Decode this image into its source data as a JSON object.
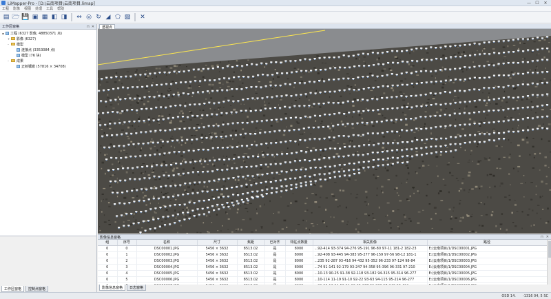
{
  "window": {
    "title": "LiMapper-Pro - [D:\\云南项目\\云南项目.limap]",
    "controls": [
      "—",
      "☐",
      "✕"
    ]
  },
  "menu": [
    "工程",
    "影像",
    "视图",
    "处理",
    "工具",
    "帮助"
  ],
  "toolbar": {
    "icons": [
      "new-file-icon",
      "open-folder-icon",
      "save-icon",
      "image-icon",
      "image-add-icon",
      "layers-icon",
      "layers-alt-icon",
      "align-icon",
      "rotate-icon",
      "refresh-icon",
      "tilt-icon",
      "model-icon",
      "export-icon",
      "close-icon"
    ],
    "glyphs": [
      "▤",
      "🗁",
      "💾",
      "▣",
      "▦",
      "◧",
      "◨",
      "⇔",
      "◎",
      "↻",
      "◢",
      "⬠",
      "▧",
      "✕"
    ]
  },
  "workspace": {
    "title": "工作区窗格",
    "tree": [
      {
        "label": "工程 (6327 影像, 48850371 点)",
        "level": 0,
        "icon": "doc",
        "tog": "▪"
      },
      {
        "label": "影像 (6327)",
        "level": 1,
        "icon": "folder",
        "tog": "+"
      },
      {
        "label": "模型",
        "level": 1,
        "icon": "folder",
        "tog": "–"
      },
      {
        "label": "连接点 (3353084 点)",
        "level": 2,
        "icon": "doc",
        "tog": ""
      },
      {
        "label": "模型 (76 块)",
        "level": 2,
        "icon": "doc",
        "tog": ""
      },
      {
        "label": "成果",
        "level": 1,
        "icon": "folder",
        "tog": "–"
      },
      {
        "label": "正射镶嵌 (57816 × 34708)",
        "level": 2,
        "icon": "doc",
        "tog": ""
      }
    ],
    "tabs": [
      "工作区窗格",
      "控制点窗格"
    ]
  },
  "viewport": {
    "tab": "透视点"
  },
  "imageinfo": {
    "title": "影像信息窗格",
    "columns": [
      "组",
      "序号",
      "名称",
      "尺寸",
      "焦距",
      "已对齐",
      "特征点数量",
      "相关影像",
      "路径"
    ],
    "rows": [
      [
        "0",
        "0",
        "DSC00001.JPG",
        "5456 × 3632",
        "8513.02",
        "是",
        "8000",
        "...92-414 93-374 94-276 95-191 96-80 97-11 181-2 182-23",
        "E:/云南项目/1/DSC00001.JPG"
      ],
      [
        "0",
        "1",
        "DSC00002.JPG",
        "5456 × 3632",
        "8513.02",
        "是",
        "8000",
        "...92-408 93-445 94-383 95-277 96-159 97-56 98-12 181-1",
        "E:/云南项目/1/DSC00002.JPG"
      ],
      [
        "0",
        "2",
        "DSC00003.JPG",
        "5456 × 3632",
        "8513.02",
        "是",
        "8000",
        "...235 92-287 93-416 94-432 95-352 96-233 97-124 98-84",
        "E:/云南项目/1/DSC00003.JPG"
      ],
      [
        "0",
        "3",
        "DSC00004.JPG",
        "5456 × 3632",
        "8513.02",
        "是",
        "8000",
        "...74 91-141 92-179 93-247 94-358 95-396 96-331 97-210",
        "E:/云南项目/1/DSC00004.JPG"
      ],
      [
        "0",
        "4",
        "DSC00005.JPG",
        "5456 × 3632",
        "8513.02",
        "是",
        "8000",
        "...10-13 90-25 91-38 92-118 93-182 94-315 95-314 96-277",
        "E:/云南项目/1/DSC00005.JPG"
      ],
      [
        "0",
        "5",
        "DSC00006.JPG",
        "5456 × 3632",
        "8513.02",
        "是",
        "8000",
        "...10-114 11-19 91-10 92-22 93-63 94-115 95-214 96-277",
        "E:/云南项目/1/DSC00006.JPG"
      ],
      [
        "0",
        "6",
        "DSC00007.JPG",
        "5456 × 3632",
        "8513.02",
        "是",
        "8000",
        "...21 96-12 94-53 94-96 95-177 96-233 97-246 98-424",
        "E:/云南项目/1/DSC00007.JPG"
      ]
    ],
    "tabs": [
      "影像信息窗格",
      "日志窗格"
    ]
  },
  "status": {
    "left": "OSD 14.",
    "right": "-1316 04, 5 SC"
  },
  "colors": {
    "track_line": "#ffe84d",
    "camera_marker": "#ffffff",
    "terrain_light": "#a29a86",
    "terrain_dark": "#2a2823",
    "sky": "#8a8c8f"
  }
}
